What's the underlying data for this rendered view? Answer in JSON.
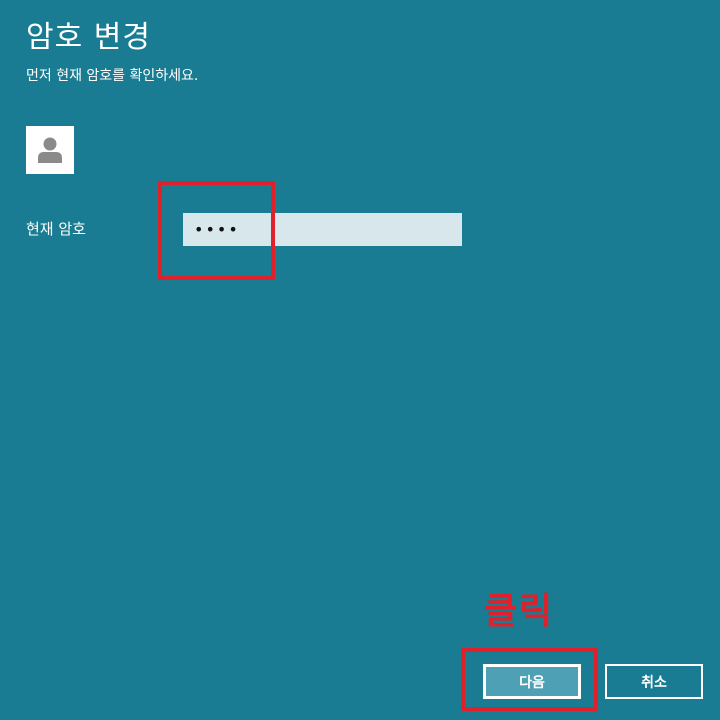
{
  "dialog": {
    "title": "암호 변경",
    "subtitle": "먼저 현재 암호를 확인하세요."
  },
  "avatar": {
    "icon": "user-icon"
  },
  "form": {
    "current_password_label": "현재 암호",
    "current_password_value": "••••"
  },
  "annotation": {
    "click_label": "클릭",
    "highlight_color": "#e0202a"
  },
  "buttons": {
    "next_label": "다음",
    "cancel_label": "취소"
  },
  "colors": {
    "background": "#197c92",
    "input_background": "#d7e7ec",
    "primary_button": "#4ea1b5"
  }
}
